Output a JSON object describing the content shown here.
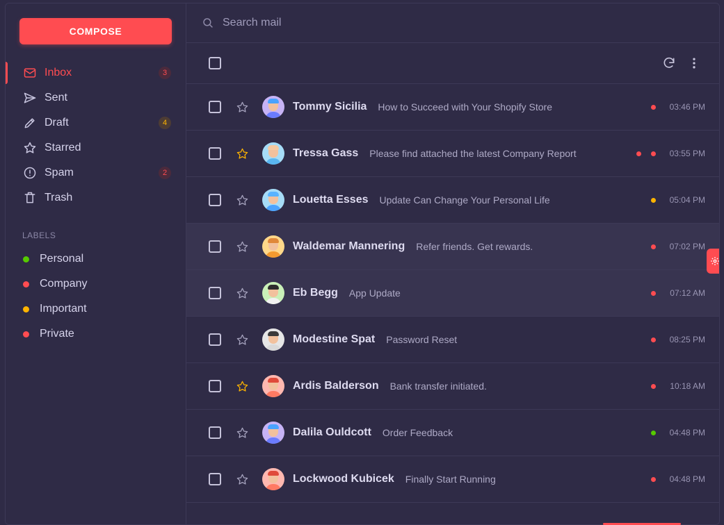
{
  "compose_label": "COMPOSE",
  "folders": [
    {
      "label": "Inbox",
      "icon": "mail-icon",
      "badge": "3",
      "badge_color": "red",
      "active": true
    },
    {
      "label": "Sent",
      "icon": "send-icon"
    },
    {
      "label": "Draft",
      "icon": "pencil-icon",
      "badge": "4",
      "badge_color": "orange"
    },
    {
      "label": "Starred",
      "icon": "star-icon"
    },
    {
      "label": "Spam",
      "icon": "alert-circle-icon",
      "badge": "2",
      "badge_color": "red"
    },
    {
      "label": "Trash",
      "icon": "trash-icon"
    }
  ],
  "labels_title": "LABELS",
  "labels": [
    {
      "label": "Personal",
      "color": "#56ca00"
    },
    {
      "label": "Company",
      "color": "#ff4c51"
    },
    {
      "label": "Important",
      "color": "#ffb400"
    },
    {
      "label": "Private",
      "color": "#ff4c51"
    }
  ],
  "search": {
    "placeholder": "Search mail"
  },
  "colors": {
    "accent": "#ff4c51",
    "warning": "#ffb400",
    "success": "#56ca00"
  },
  "mails": [
    {
      "name": "Tommy Sicilia",
      "subject": "How to Succeed with Your Shopify Store",
      "time": "03:46 PM",
      "starred": false,
      "dots": [
        "#ff4c51"
      ],
      "read": false,
      "avatar_bg": "#c7b3f5",
      "hair": "#4aa3ff",
      "body": "#6b7cff"
    },
    {
      "name": "Tressa Gass",
      "subject": "Please find attached the latest Company Report",
      "time": "03:55 PM",
      "starred": true,
      "dots": [
        "#ff4c51",
        "#ff4c51"
      ],
      "read": false,
      "avatar_bg": "#a6dcf7",
      "hair": "#f5c9a0",
      "body": "#5ab6f0"
    },
    {
      "name": "Louetta Esses",
      "subject": "Update Can Change Your Personal Life",
      "time": "05:04 PM",
      "starred": false,
      "dots": [
        "#ffb400"
      ],
      "read": false,
      "avatar_bg": "#a6dcf7",
      "hair": "#58b3ff",
      "body": "#4aa3ff"
    },
    {
      "name": "Waldemar Mannering",
      "subject": "Refer friends. Get rewards.",
      "time": "07:02 PM",
      "starred": false,
      "dots": [
        "#ff4c51"
      ],
      "read": true,
      "avatar_bg": "#ffd88a",
      "hair": "#e0883a",
      "body": "#f39a2f"
    },
    {
      "name": "Eb Begg",
      "subject": "App Update",
      "time": "07:12 AM",
      "starred": false,
      "dots": [
        "#ff4c51"
      ],
      "read": true,
      "avatar_bg": "#c9f0b8",
      "hair": "#2d2d2d",
      "body": "#f2f2f2"
    },
    {
      "name": "Modestine Spat",
      "subject": "Password Reset",
      "time": "08:25 PM",
      "starred": false,
      "dots": [
        "#ff4c51"
      ],
      "read": false,
      "avatar_bg": "#e6e6e6",
      "hair": "#3a3a3a",
      "body": "#d9d9d9"
    },
    {
      "name": "Ardis Balderson",
      "subject": "Bank transfer initiated.",
      "time": "10:18 AM",
      "starred": true,
      "dots": [
        "#ff4c51"
      ],
      "read": false,
      "avatar_bg": "#ffb8b0",
      "hair": "#e04a3a",
      "body": "#ff7a63"
    },
    {
      "name": "Dalila Ouldcott",
      "subject": "Order Feedback",
      "time": "04:48 PM",
      "starred": false,
      "dots": [
        "#56ca00"
      ],
      "read": false,
      "avatar_bg": "#c7b3f5",
      "hair": "#4aa3ff",
      "body": "#6b7cff"
    },
    {
      "name": "Lockwood Kubicek",
      "subject": "Finally Start Running",
      "time": "04:48 PM",
      "starred": false,
      "dots": [
        "#ff4c51"
      ],
      "read": false,
      "avatar_bg": "#ffb8b0",
      "hair": "#e04a3a",
      "body": "#ff7a63"
    }
  ]
}
